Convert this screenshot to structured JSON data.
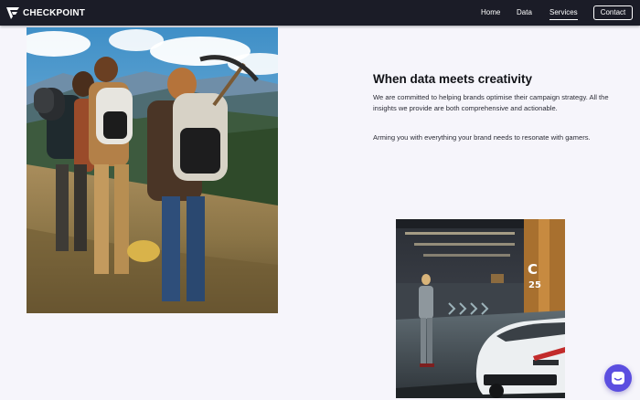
{
  "brand": {
    "name": "CHECKPOINT",
    "logo_icon": "checkpoint-logo-icon"
  },
  "nav": {
    "links": [
      {
        "label": "Home"
      },
      {
        "label": "Data"
      },
      {
        "label": "Services",
        "active": true
      }
    ],
    "contact_label": "Contact"
  },
  "section": {
    "headline": "When data meets creativity",
    "paragraphs": [
      "We are committed to helping brands optimise their campaign strategy. All the insights we provide are both comprehensive and actionable.",
      "Arming you with everything your brand needs to resonate with gamers."
    ]
  },
  "car_photo": {
    "garage_sign": "C",
    "bay_number": "25"
  },
  "chat": {
    "icon": "chat-icon",
    "accent": "#5b4ee0"
  },
  "colors": {
    "navbar": "#1b1c27",
    "page": "#f6f5fb",
    "text": "#1a1b26"
  }
}
